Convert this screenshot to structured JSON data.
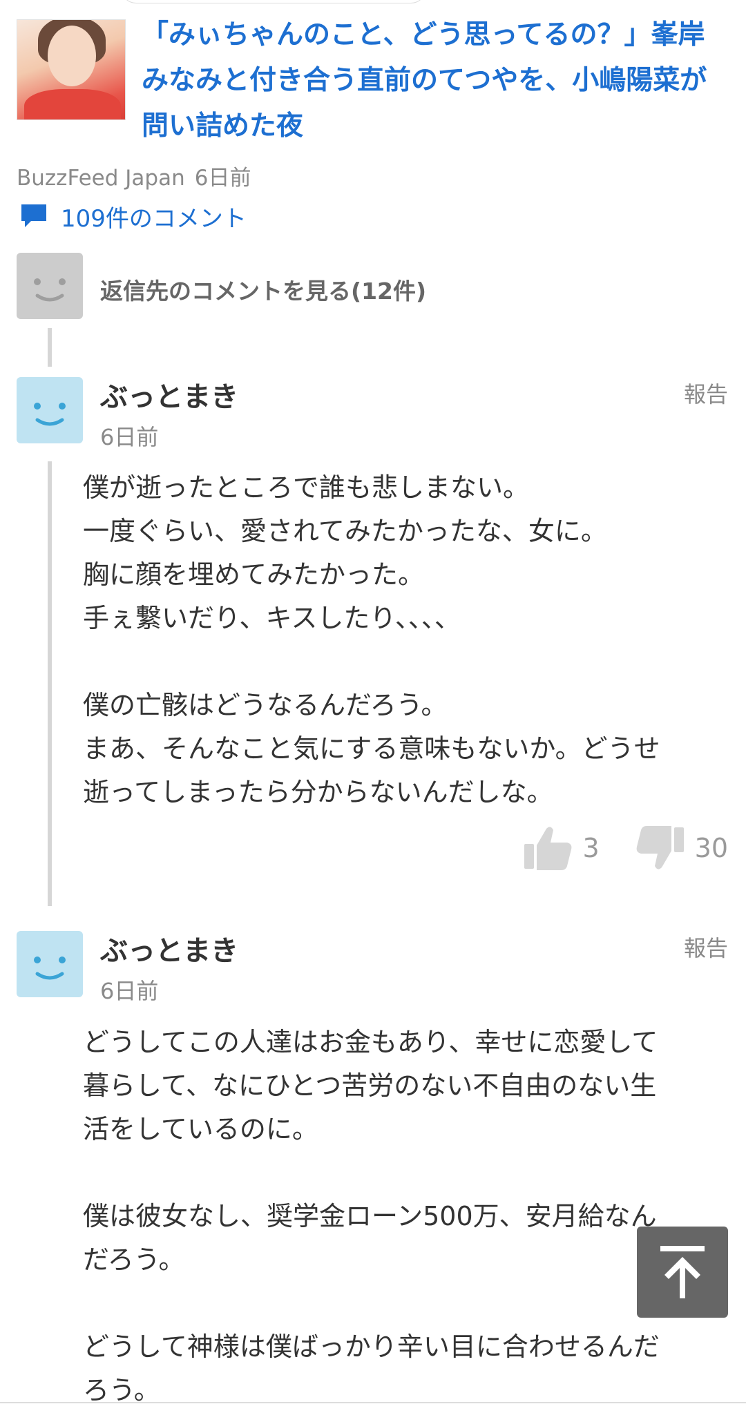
{
  "article": {
    "title": "「みぃちゃんのこと、どう思ってるの？」峯岸みなみと付き合う直前のてつやを、小嶋陽菜が問い詰めた夜",
    "source": "BuzzFeed Japan",
    "time": "6日前",
    "comment_count_label": "109件のコメント",
    "thumbnail_icon": "article-thumbnail"
  },
  "reply_parent": {
    "label": "返信先のコメントを見る(12件)",
    "avatar_icon": "gray-smiley-avatar"
  },
  "comments": [
    {
      "user": "ぶっとまき",
      "time": "6日前",
      "report_label": "報告",
      "avatar_icon": "blue-smiley-avatar",
      "lines": [
        "僕が逝ったところで誰も悲しまない。",
        "一度ぐらい、愛されてみたかったな、女に。",
        "胸に顔を埋めてみたかった。",
        "手ぇ繋いだり、キスしたり、、、、",
        "",
        "僕の亡骸はどうなるんだろう。",
        "まあ、そんなこと気にする意味もないか。どうせ",
        "逝ってしまったら分からないんだしな。"
      ],
      "likes": "3",
      "dislikes": "30"
    },
    {
      "user": "ぶっとまき",
      "time": "6日前",
      "report_label": "報告",
      "avatar_icon": "blue-smiley-avatar",
      "lines": [
        "どうしてこの人達はお金もあり、幸せに恋愛して",
        "暮らして、なにひとつ苦労のない不自由のない生",
        "活をしているのに。",
        "",
        "僕は彼女なし、奨学金ローン500万、安月給なん",
        "だろう。",
        "",
        "どうして神様は僕ばっかり辛い目に合わせるんだ",
        "ろう。"
      ]
    }
  ],
  "colors": {
    "link_blue": "#1d6fd1",
    "text_dark": "#333333",
    "text_gray": "#8a8a8a",
    "avatar_blue": "#bfe3f2",
    "avatar_blue_face": "#3aa4d6",
    "avatar_gray": "#cccccc",
    "back_to_top_bg": "#666666"
  },
  "icons": {
    "comment": "speech-bubble-icon",
    "like": "thumbs-up-icon",
    "dislike": "thumbs-down-icon",
    "back_to_top": "arrow-up-to-line-icon"
  }
}
